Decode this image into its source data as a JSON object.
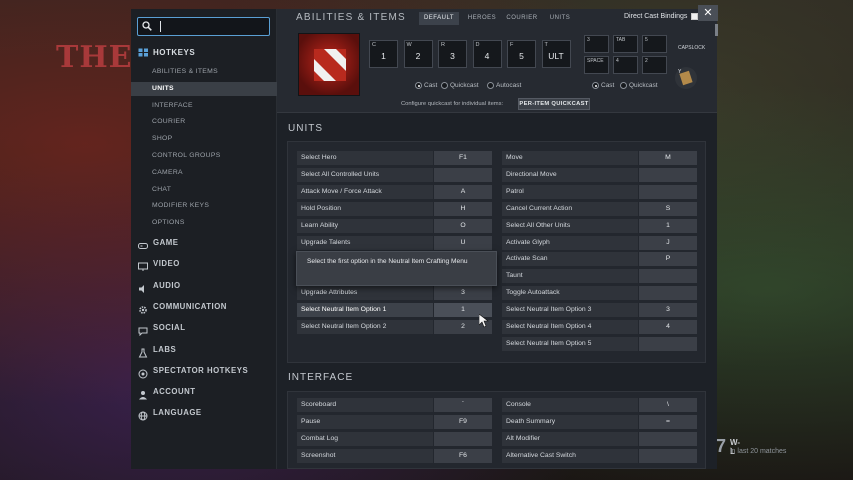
{
  "background": {
    "title": "THE D",
    "wl_number": "7",
    "wl_label": "W-L",
    "wl_sub": "in last 20 matches"
  },
  "search": {
    "value": ""
  },
  "sidebar": {
    "hotkeys_label": "HOTKEYS",
    "subitems": [
      "ABILITIES & ITEMS",
      "UNITS",
      "INTERFACE",
      "COURIER",
      "SHOP",
      "CONTROL GROUPS",
      "CAMERA",
      "CHAT",
      "MODIFIER KEYS",
      "OPTIONS"
    ],
    "active_subitem": "UNITS",
    "categories": [
      {
        "label": "GAME",
        "icon": "gamepad-icon"
      },
      {
        "label": "VIDEO",
        "icon": "monitor-icon"
      },
      {
        "label": "AUDIO",
        "icon": "speaker-icon"
      },
      {
        "label": "COMMUNICATION",
        "icon": "gear-icon"
      },
      {
        "label": "SOCIAL",
        "icon": "chat-icon"
      },
      {
        "label": "LABS",
        "icon": "flask-icon"
      },
      {
        "label": "SPECTATOR HOTKEYS",
        "icon": "spectator-icon"
      },
      {
        "label": "ACCOUNT",
        "icon": "user-icon"
      },
      {
        "label": "LANGUAGE",
        "icon": "globe-icon"
      }
    ]
  },
  "header": {
    "title": "ABILITIES & ITEMS",
    "tabs": [
      "DEFAULT",
      "HEROES",
      "COURIER",
      "UNITS"
    ],
    "active_tab": "DEFAULT",
    "direct_cast": "Direct Cast Bindings",
    "close": "✕"
  },
  "abilities": [
    {
      "ab": "C",
      "key": "1"
    },
    {
      "ab": "W",
      "key": "2"
    },
    {
      "ab": "R",
      "key": "3"
    },
    {
      "ab": "D",
      "key": "4"
    },
    {
      "ab": "F",
      "key": "5"
    },
    {
      "ab": "T",
      "key": "ULT"
    }
  ],
  "cast_modes": {
    "cast": "Cast",
    "quickcast": "Quickcast",
    "autocast": "Autocast"
  },
  "items": [
    {
      "ab": "3",
      "key": ""
    },
    {
      "ab": "TAB",
      "key": ""
    },
    {
      "ab": "5",
      "key": ""
    },
    {
      "ab": "SPACE",
      "key": ""
    },
    {
      "ab": "4",
      "key": ""
    },
    {
      "ab": "2",
      "key": ""
    }
  ],
  "items_cast": {
    "cast": "Cast",
    "quickcast": "Quickcast"
  },
  "capslock": "CAPSLOCK",
  "y_key": "Y",
  "configure": "Configure quickcast for individual items:",
  "per_item": "PER-ITEM QUICKCAST",
  "units_title": "UNITS",
  "units_left": [
    {
      "name": "Select Hero",
      "key": "F1"
    },
    {
      "name": "Select All Controlled Units",
      "key": ""
    },
    {
      "name": "Attack Move / Force Attack",
      "key": "A"
    },
    {
      "name": "Hold Position",
      "key": "H"
    },
    {
      "name": "Learn Ability",
      "key": "O"
    },
    {
      "name": "Upgrade Talents",
      "key": "U"
    },
    {
      "name": "",
      "key": ""
    },
    {
      "name": "",
      "key": ""
    },
    {
      "name": "Upgrade Attributes",
      "key": "3"
    },
    {
      "name": "Select Neutral Item Option 1",
      "key": "1"
    },
    {
      "name": "Select Neutral Item Option 2",
      "key": "2"
    }
  ],
  "units_right": [
    {
      "name": "Move",
      "key": "M"
    },
    {
      "name": "Directional Move",
      "key": ""
    },
    {
      "name": "Patrol",
      "key": ""
    },
    {
      "name": "Cancel Current Action",
      "key": "S"
    },
    {
      "name": "Select All Other Units",
      "key": "1"
    },
    {
      "name": "Activate Glyph",
      "key": "J"
    },
    {
      "name": "Activate Scan",
      "key": "P"
    },
    {
      "name": "Taunt",
      "key": ""
    },
    {
      "name": "Toggle Autoattack",
      "key": ""
    },
    {
      "name": "Select Neutral Item Option 3",
      "key": "3"
    },
    {
      "name": "Select Neutral Item Option 4",
      "key": "4"
    },
    {
      "name": "Select Neutral Item Option 5",
      "key": ""
    }
  ],
  "tooltip": "Select the first option in the Neutral Item Crafting Menu",
  "interface_title": "INTERFACE",
  "interface_left": [
    {
      "name": "Scoreboard",
      "key": "`"
    },
    {
      "name": "Pause",
      "key": "F9"
    },
    {
      "name": "Combat Log",
      "key": ""
    },
    {
      "name": "Screenshot",
      "key": "F6"
    }
  ],
  "interface_right": [
    {
      "name": "Console",
      "key": "\\"
    },
    {
      "name": "Death Summary",
      "key": "="
    },
    {
      "name": "Alt Modifier",
      "key": ""
    },
    {
      "name": "Alternative Cast Switch",
      "key": ""
    }
  ]
}
